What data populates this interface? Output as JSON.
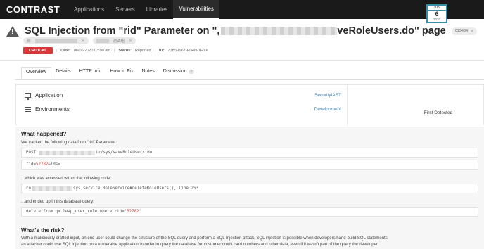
{
  "nav": {
    "logo": "CONTRAST",
    "items": [
      "Applications",
      "Servers",
      "Libraries",
      "Vulnerabilities"
    ]
  },
  "header": {
    "title_prefix": "SQL Injection from \"rid\" Parameter on \",",
    "title_suffix": "veRoleUsers.do\" page",
    "trace_badge": "013484"
  },
  "tags": [
    {
      "text": "测"
    },
    {
      "text": "测试组"
    }
  ],
  "meta": {
    "severity": "CRITICAL",
    "date_label": "Date:",
    "date_value": "06/06/2020 03:00 am",
    "status_label": "Status:",
    "status_value": "Reported",
    "id_label": "ID:",
    "id_value": "70B5-I96Z-H34N-7H1X"
  },
  "tabs": [
    {
      "label": "Overview"
    },
    {
      "label": "Details"
    },
    {
      "label": "HTTP Info"
    },
    {
      "label": "How to Fix"
    },
    {
      "label": "Notes"
    },
    {
      "label": "Discussion",
      "count": "0"
    }
  ],
  "summary": {
    "application_label": "Application",
    "application_value": "SecurityIAST",
    "environments_label": "Environments",
    "environments_value": "Development",
    "first_detected_label": "First Detected",
    "calendar": {
      "month": "JUN",
      "day": "6",
      "year": "2020"
    }
  },
  "what_happened": {
    "heading": "What happened?",
    "tracked_text": "We tracked the following data from \"rid\" Parameter:",
    "request_line_prefix": "POST",
    "request_line_suffix": "iz/sys/saveRoleUsers.do",
    "param_prefix": "rid=",
    "param_value": "52782",
    "param_suffix": "&ids=",
    "accessed_text": "...which was accessed within the following code:",
    "code_prefix": "co",
    "code_suffix": "sys.service.RoleService#deleteRoleUsers(), line 253",
    "ended_text": "...and ended up in this database query:",
    "query_prefix": "delete from qx.leap_user_role where rid='",
    "query_value": "52782",
    "query_suffix": "'"
  },
  "risk": {
    "heading": "What's the risk?",
    "line1": "With a maliciously crafted input, an end user could change the structure of the SQL query and perform a SQL Injection attack. SQL injection is possible when developers hand-build SQL statements",
    "line2": "an attacker could use SQL Injection on a vulnerable application in order to query the database for customer credit card numbers and other data, even if it wasn't part of the query the developer"
  },
  "colors": {
    "critical": "#d63a3a",
    "link": "#3f7fb4",
    "tainted": "#d23b3b"
  }
}
